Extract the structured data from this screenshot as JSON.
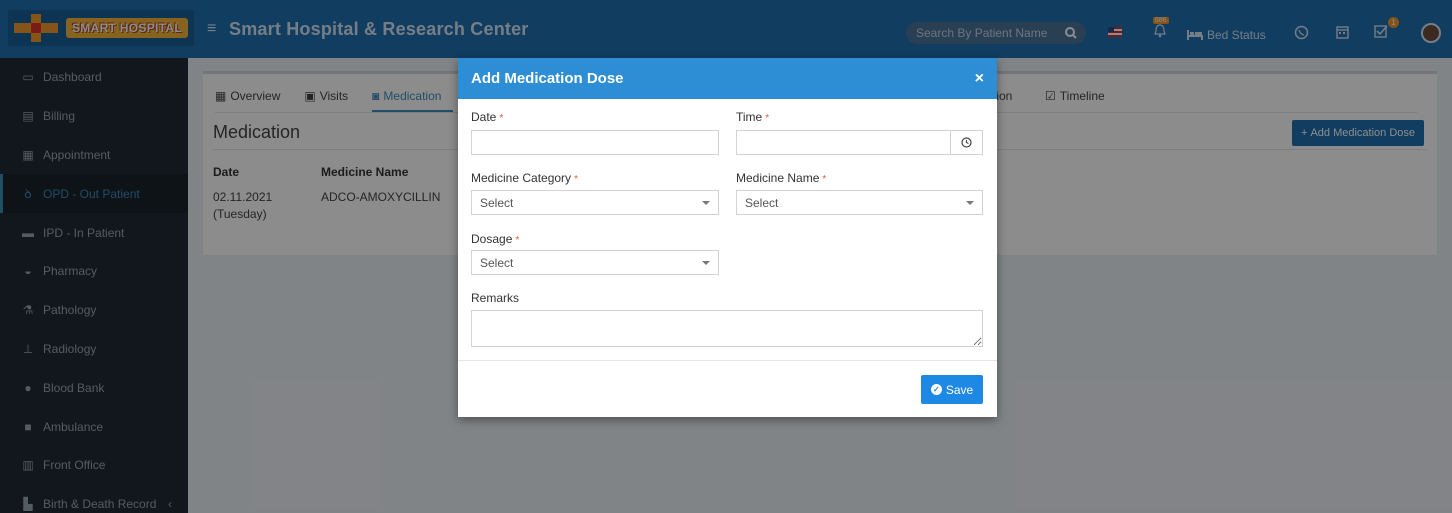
{
  "header": {
    "logo_text": "SMART HOSPITAL",
    "title": "Smart Hospital & Research Center",
    "search_placeholder": "Search By Patient Name",
    "notification_count": "686",
    "bed_status": "Bed Status",
    "task_count": "1"
  },
  "sidebar": {
    "items": [
      {
        "label": "Dashboard",
        "icon": "monitor-icon"
      },
      {
        "label": "Billing",
        "icon": "bill-icon"
      },
      {
        "label": "Appointment",
        "icon": "calendar-icon"
      },
      {
        "label": "OPD - Out Patient",
        "icon": "stethoscope-icon"
      },
      {
        "label": "IPD - In Patient",
        "icon": "bed-icon"
      },
      {
        "label": "Pharmacy",
        "icon": "mortar-pestle-icon"
      },
      {
        "label": "Pathology",
        "icon": "flask-icon"
      },
      {
        "label": "Radiology",
        "icon": "radiology-icon"
      },
      {
        "label": "Blood Bank",
        "icon": "blood-drop-icon"
      },
      {
        "label": "Ambulance",
        "icon": "ambulance-icon"
      },
      {
        "label": "Front Office",
        "icon": "building-icon"
      },
      {
        "label": "Birth & Death Record",
        "icon": "record-icon"
      }
    ],
    "active_index": 3
  },
  "content": {
    "tabs": [
      {
        "label": "Overview",
        "icon": "grid-icon"
      },
      {
        "label": "Visits",
        "icon": "square-icon"
      },
      {
        "label": "Medication",
        "icon": "camera-icon"
      },
      {
        "label": "tion",
        "icon": ""
      },
      {
        "label": "Timeline",
        "icon": "calendar-check-icon"
      }
    ],
    "panel_title": "Medication",
    "add_button": "Add Medication Dose",
    "table": {
      "headers": [
        "Date",
        "Medicine Name"
      ],
      "row_date": "02.11.2021",
      "row_day": "(Tuesday)",
      "row_medicine": "ADCO-AMOXYCILLIN"
    }
  },
  "modal": {
    "title": "Add Medication Dose",
    "close": "×",
    "date_label": "Date",
    "time_label": "Time",
    "medicine_category_label": "Medicine Category",
    "medicine_name_label": "Medicine Name",
    "dosage_label": "Dosage",
    "remarks_label": "Remarks",
    "required_mark": "*",
    "select_placeholder": "Select",
    "save_label": "Save"
  },
  "colors": {
    "header_bg": "#1f6fb0",
    "modal_header": "#2d8ed6",
    "sidebar_bg": "#1f2a33",
    "accent": "#3c8dbc",
    "save_button": "#1e88e5"
  }
}
